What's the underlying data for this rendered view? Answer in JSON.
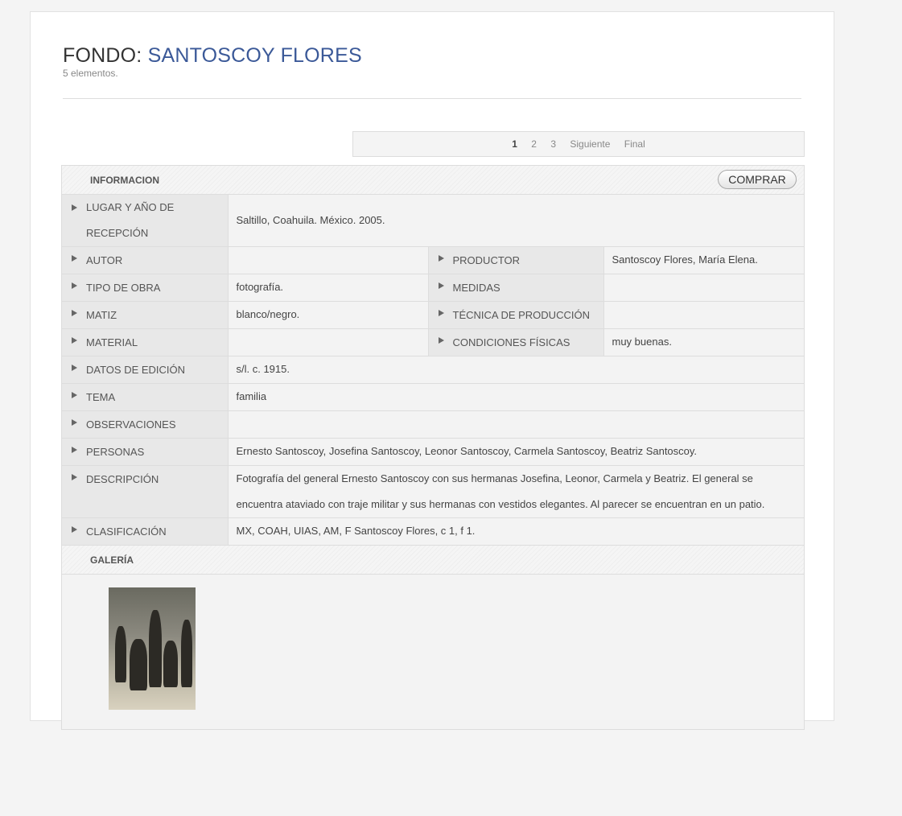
{
  "header": {
    "prefix": "FONDO:",
    "name": "SANTOSCOY FLORES",
    "count": "5 elementos."
  },
  "pager": {
    "pages": [
      "1",
      "2",
      "3"
    ],
    "next": "Siguiente",
    "last": "Final"
  },
  "info": {
    "heading": "INFORMACION",
    "buy_label": "COMPRAR",
    "lugar_label": "LUGAR Y AÑO DE RECEPCIÓN",
    "lugar": "Saltillo, Coahuila. México. 2005.",
    "autor_label": "AUTOR",
    "autor": "",
    "productor_label": "PRODUCTOR",
    "productor": "Santoscoy Flores, María Elena.",
    "tipo_label": "TIPO DE OBRA",
    "tipo": "fotografía.",
    "medidas_label": "MEDIDAS",
    "medidas": "",
    "matiz_label": "MATIZ",
    "matiz": "blanco/negro.",
    "tecnica_label": "TÉCNICA DE PRODUCCIÓN",
    "tecnica": "",
    "material_label": "MATERIAL",
    "material": "",
    "condiciones_label": "CONDICIONES FÍSICAS",
    "condiciones": "muy buenas.",
    "edicion_label": "DATOS DE EDICIÓN",
    "edicion": "s/l. c. 1915.",
    "tema_label": "TEMA",
    "tema": "familia",
    "observaciones_label": "OBSERVACIONES",
    "observaciones": "",
    "personas_label": "PERSONAS",
    "personas": "Ernesto Santoscoy, Josefina Santoscoy, Leonor Santoscoy, Carmela Santoscoy, Beatriz Santoscoy.",
    "descripcion_label": "DESCRIPCIÓN",
    "descripcion": "Fotografía del general Ernesto Santoscoy con sus hermanas Josefina, Leonor, Carmela y Beatriz. El general se encuentra ataviado con traje militar y sus hermanas con vestidos elegantes. Al parecer se encuentran en un patio.",
    "clasificacion_label": "CLASIFICACIÓN",
    "clasificacion": "MX, COAH, UIAS, AM, F Santoscoy Flores, c 1, f 1."
  },
  "gallery": {
    "heading": "GALERÍA"
  },
  "colors": {
    "accent": "#3b5998",
    "panel": "#f3f3f3",
    "label_cell": "#e8e8e8"
  }
}
